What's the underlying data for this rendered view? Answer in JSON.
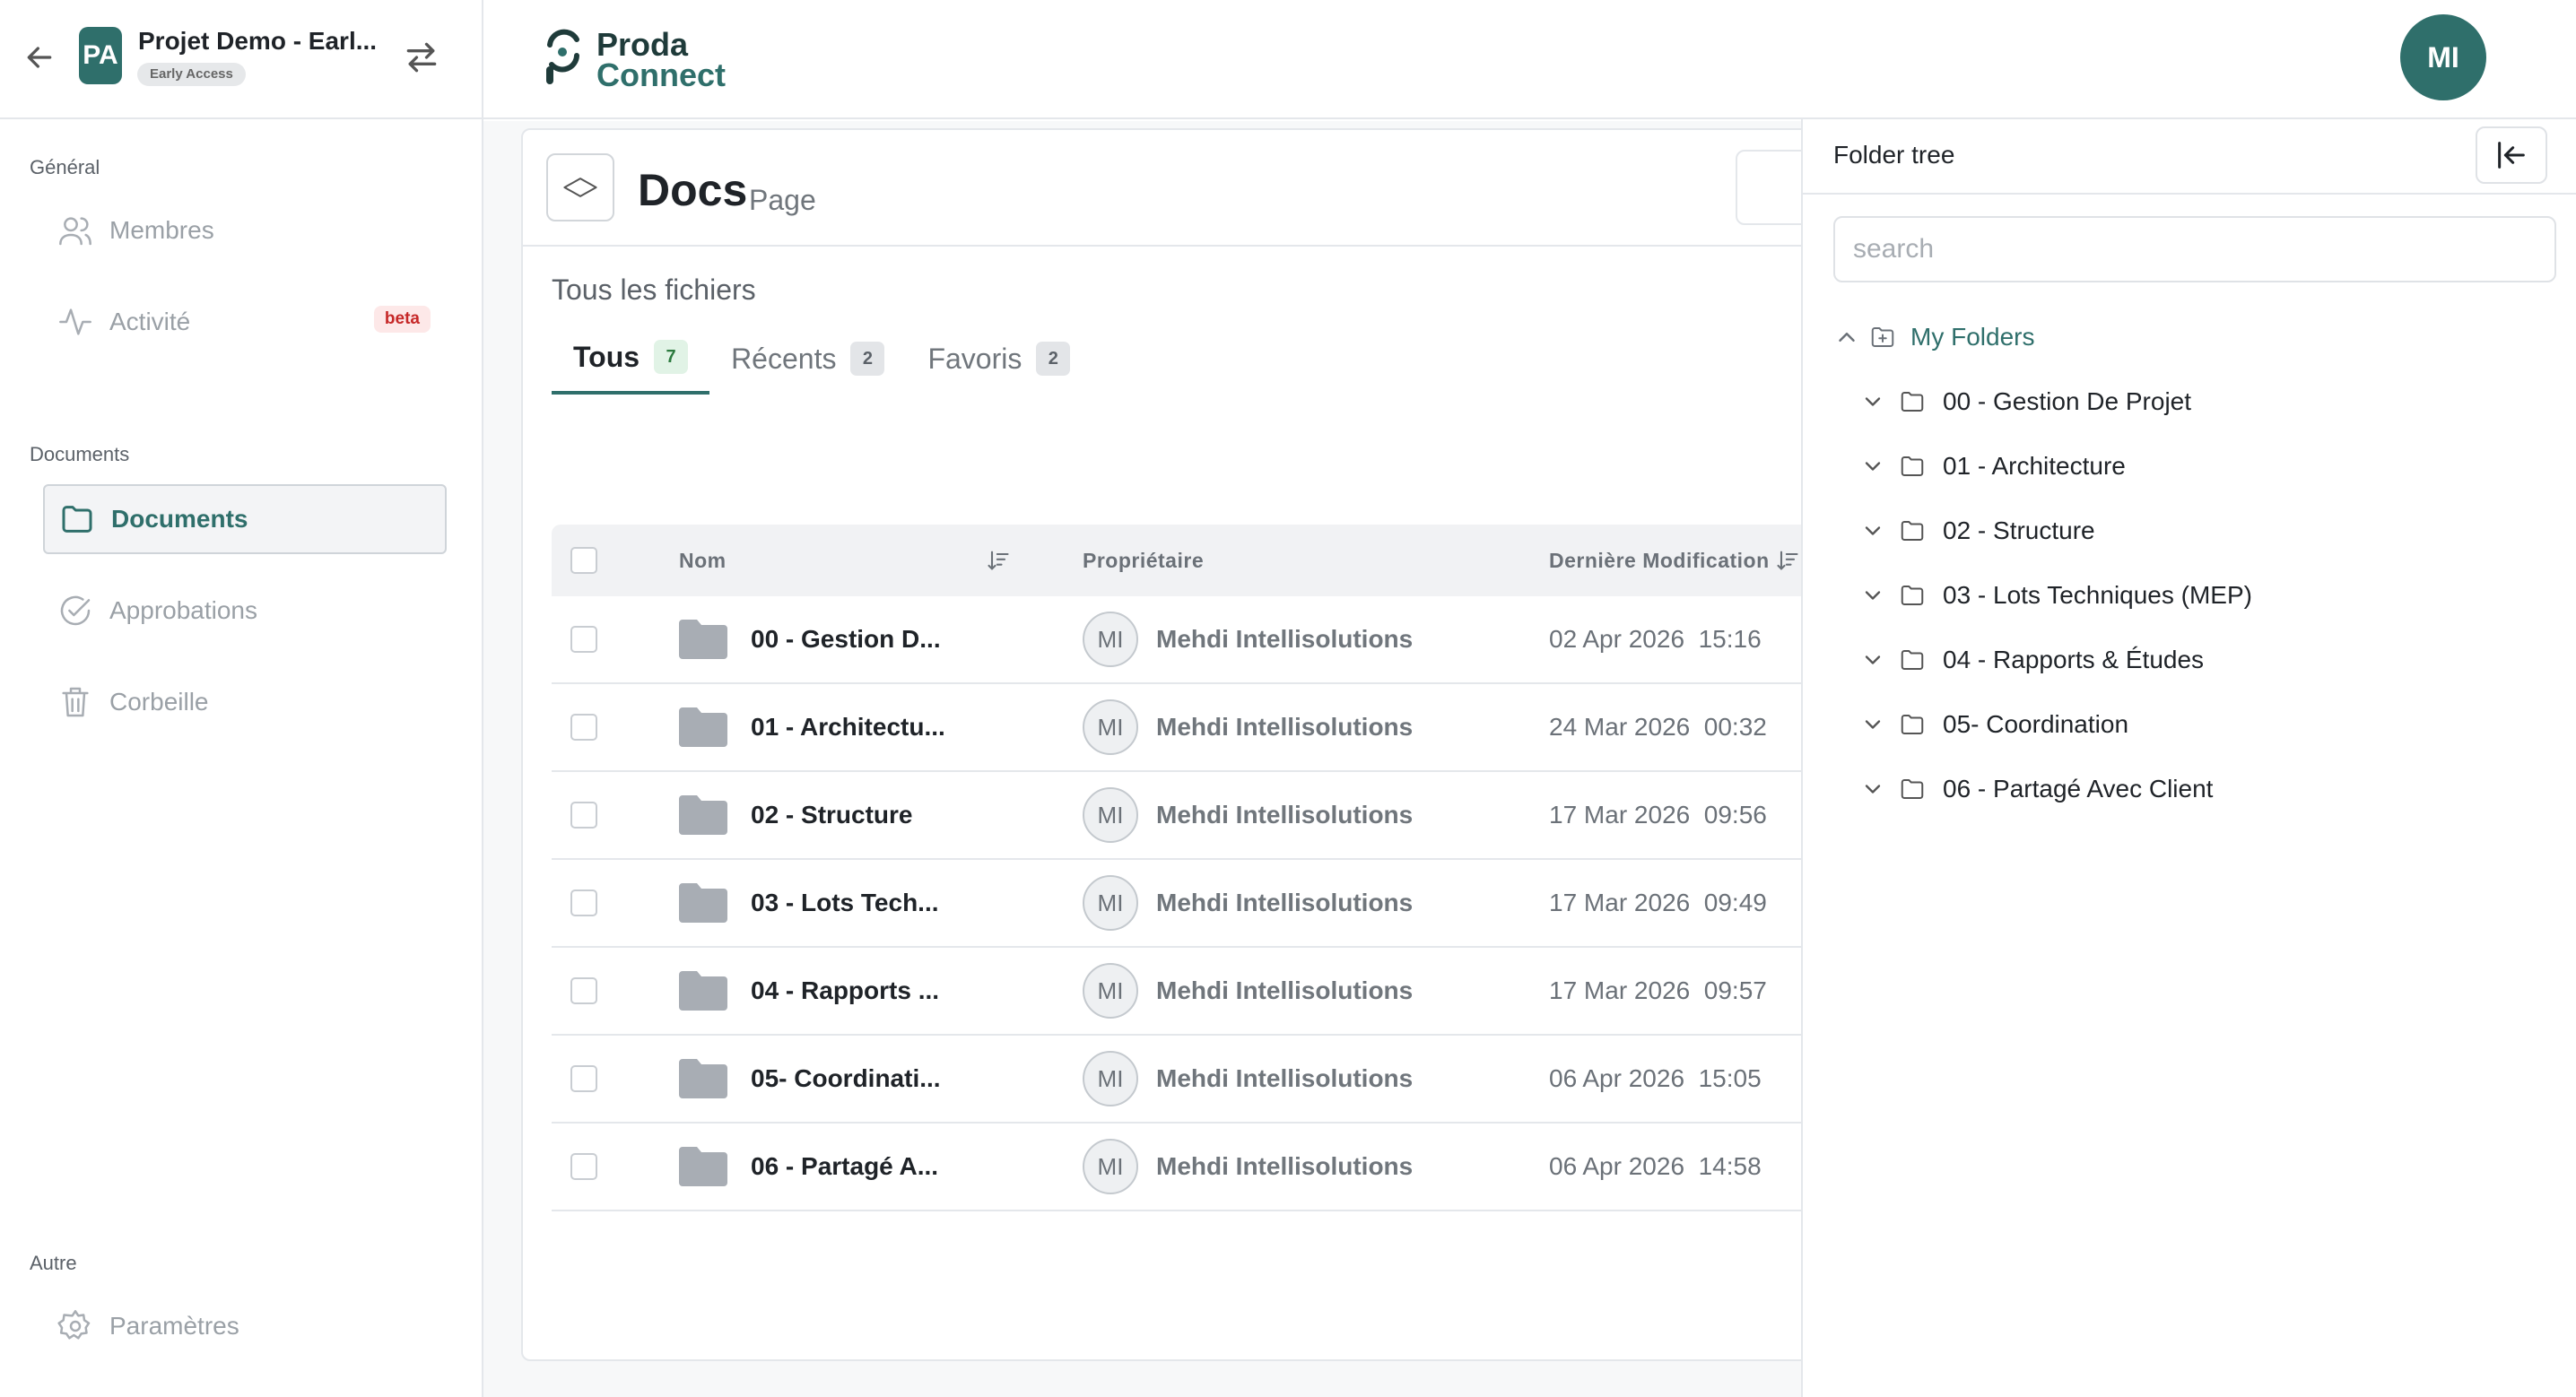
{
  "project": {
    "avatar_initials": "PA",
    "name": "Projet Demo - Earl...",
    "badge": "Early Access"
  },
  "sidebar": {
    "section_general": "Général",
    "membres": "Membres",
    "activite": "Activité",
    "activite_badge": "beta",
    "section_documents": "Documents",
    "documents": "Documents",
    "approbations": "Approbations",
    "corbeille": "Corbeille",
    "section_autre": "Autre",
    "parametres": "Paramètres"
  },
  "logo": {
    "line1": "Proda",
    "line2": "Connect"
  },
  "user": {
    "initials": "MI"
  },
  "page": {
    "title": "Docs",
    "subtitle": "Page",
    "all_files": "Tous les fichiers"
  },
  "tabs": [
    {
      "label": "Tous",
      "count": "7"
    },
    {
      "label": "Récents",
      "count": "2"
    },
    {
      "label": "Favoris",
      "count": "2"
    }
  ],
  "table": {
    "col_name": "Nom",
    "col_owner": "Propriétaire",
    "col_modified": "Dernière Modification",
    "rows": [
      {
        "name": "00 - Gestion D...",
        "owner_initials": "MI",
        "owner": "Mehdi Intellisolutions",
        "date": "02 Apr 2026  15:16"
      },
      {
        "name": "01 - Architectu...",
        "owner_initials": "MI",
        "owner": "Mehdi Intellisolutions",
        "date": "24 Mar 2026  00:32"
      },
      {
        "name": "02 - Structure",
        "owner_initials": "MI",
        "owner": "Mehdi Intellisolutions",
        "date": "17 Mar 2026  09:56"
      },
      {
        "name": "03 - Lots Tech...",
        "owner_initials": "MI",
        "owner": "Mehdi Intellisolutions",
        "date": "17 Mar 2026  09:49"
      },
      {
        "name": "04 - Rapports ...",
        "owner_initials": "MI",
        "owner": "Mehdi Intellisolutions",
        "date": "17 Mar 2026  09:57"
      },
      {
        "name": "05- Coordinati...",
        "owner_initials": "MI",
        "owner": "Mehdi Intellisolutions",
        "date": "06 Apr 2026  15:05"
      },
      {
        "name": "06 - Partagé A...",
        "owner_initials": "MI",
        "owner": "Mehdi Intellisolutions",
        "date": "06 Apr 2026  14:58"
      }
    ]
  },
  "folder_tree": {
    "title": "Folder tree",
    "search_placeholder": "search",
    "root": "My Folders",
    "nodes": [
      "00 - Gestion De Projet",
      "01 - Architecture",
      "02 - Structure",
      "03 - Lots Techniques (MEP)",
      "04 - Rapports & Études",
      "05- Coordination",
      "06 - Partagé Avec Client"
    ]
  },
  "colors": {
    "brand": "#2f6f6b",
    "beta": "#c62828",
    "tab_count_active": "#2b7a3e"
  }
}
